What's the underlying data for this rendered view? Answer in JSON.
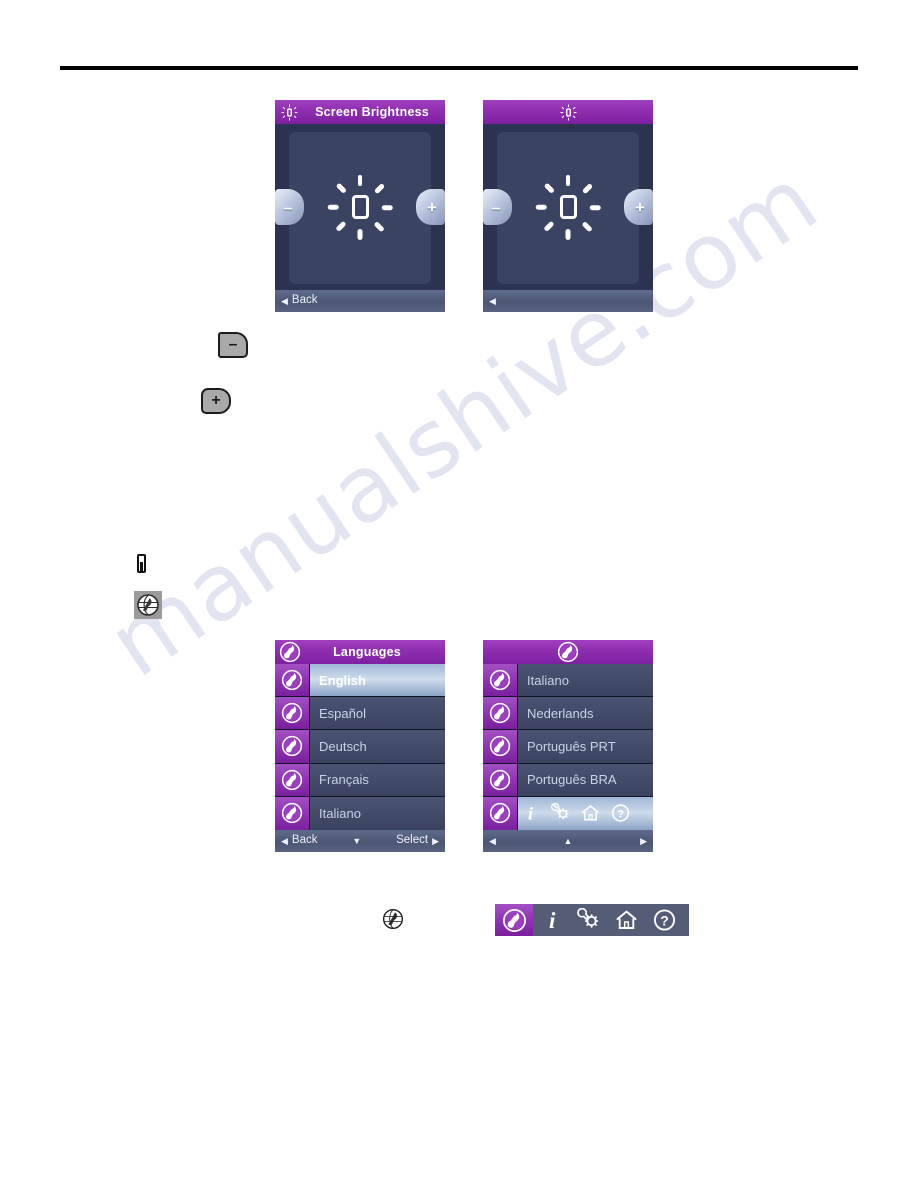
{
  "page": {
    "watermark_text": "manualshive.com",
    "rule_color": "#000000"
  },
  "colors": {
    "title_purple": "#8e2fb0",
    "screen_background": "#2b3350",
    "panel_background": "#3b4363",
    "navbar": "#4b5674",
    "row_unselected": "#3f4865",
    "row_selected": "#cfdcec",
    "icon_cell_purple": "#8d32b1",
    "key_grey": "#a9a9a9"
  },
  "brightness_screen_left": {
    "title": "Screen Brightness",
    "title_icon": "brightness-icon",
    "minus_button_label": "–",
    "plus_button_label": "+",
    "center_icon": "brightness-bulb-icon",
    "navbar": {
      "back_arrow": "◀",
      "back_label": "Back"
    }
  },
  "brightness_screen_right": {
    "title": "",
    "title_icon": "brightness-icon",
    "minus_button_label": "–",
    "plus_button_label": "+",
    "center_icon": "brightness-bulb-icon",
    "navbar": {
      "back_arrow": "◀",
      "back_label": ""
    }
  },
  "languages_screen_left": {
    "title": "Languages",
    "title_icon": "globe-icon",
    "rows": [
      {
        "label": "English",
        "icon": "globe-icon",
        "selected": true
      },
      {
        "label": "Español",
        "icon": "globe-icon",
        "selected": false
      },
      {
        "label": "Deutsch",
        "icon": "globe-icon",
        "selected": false
      },
      {
        "label": "Français",
        "icon": "globe-icon",
        "selected": false
      },
      {
        "label": "Italiano",
        "icon": "globe-icon",
        "selected": false
      }
    ],
    "navbar": {
      "back_arrow": "◀",
      "back_label": "Back",
      "down_arrow": "▼",
      "select_label": "Select",
      "select_arrow": "▶"
    }
  },
  "languages_screen_right": {
    "title": "",
    "title_icon": "globe-icon",
    "rows": [
      {
        "label": "Italiano",
        "icon": "globe-icon",
        "selected": false
      },
      {
        "label": "Nederlands",
        "icon": "globe-icon",
        "selected": false
      },
      {
        "label": "Português PRT",
        "icon": "globe-icon",
        "selected": false
      },
      {
        "label": "Português BRA",
        "icon": "globe-icon",
        "selected": false
      }
    ],
    "toolbar_row": {
      "icon": "globe-icon",
      "selected": true,
      "glyphs": [
        "info-icon",
        "settings-wrench-gear-icon",
        "home-icon",
        "help-question-icon"
      ]
    },
    "navbar": {
      "back_arrow": "◀",
      "up_arrow": "▲",
      "forward_arrow": "▶"
    }
  },
  "figures": {
    "minus_key": {
      "glyph": "–",
      "name": "minus-key-button"
    },
    "plus_key": {
      "glyph": "+",
      "name": "plus-key-button"
    },
    "remote_icon": {
      "name": "remote-device-icon"
    },
    "globe_box_icon": {
      "name": "globe-button-icon"
    },
    "globe_outline_icon": {
      "name": "globe-outline-icon"
    },
    "toolbar_strip": {
      "globe_icon": "globe-icon",
      "glyphs": [
        "info-icon",
        "settings-wrench-gear-icon",
        "home-icon",
        "help-question-icon"
      ]
    }
  }
}
